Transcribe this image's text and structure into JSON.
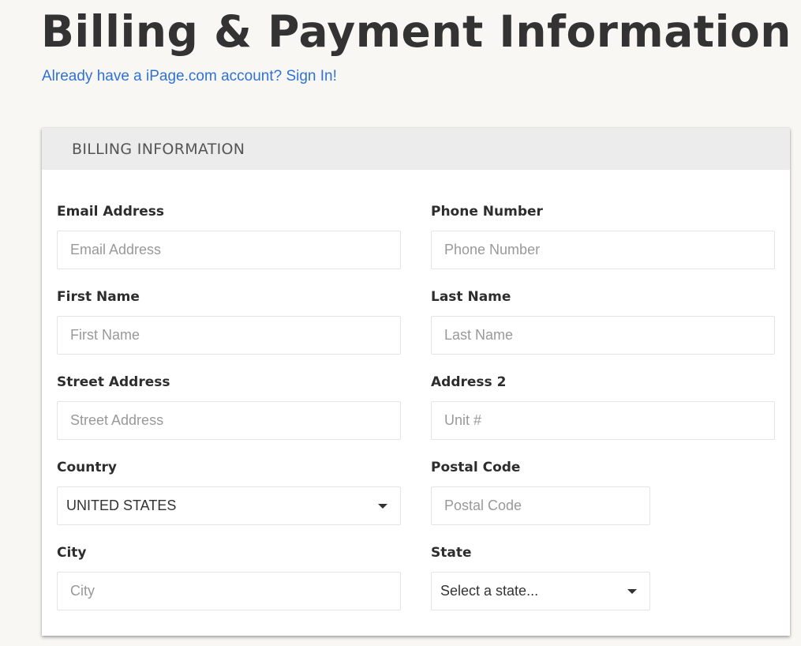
{
  "page": {
    "title": "Billing & Payment Information",
    "signin_link": "Already have a iPage.com account? Sign In!"
  },
  "billing": {
    "section_title": "BILLING INFORMATION",
    "fields": {
      "email": {
        "label": "Email Address",
        "placeholder": "Email Address",
        "value": ""
      },
      "phone": {
        "label": "Phone Number",
        "placeholder": "Phone Number",
        "value": ""
      },
      "first_name": {
        "label": "First Name",
        "placeholder": "First Name",
        "value": ""
      },
      "last_name": {
        "label": "Last Name",
        "placeholder": "Last Name",
        "value": ""
      },
      "street": {
        "label": "Street Address",
        "placeholder": "Street Address",
        "value": ""
      },
      "address2": {
        "label": "Address 2",
        "placeholder": "Unit #",
        "value": ""
      },
      "country": {
        "label": "Country",
        "selected": "UNITED STATES",
        "icon": "caret-down-icon"
      },
      "postal": {
        "label": "Postal Code",
        "placeholder": "Postal Code",
        "value": ""
      },
      "city": {
        "label": "City",
        "placeholder": "City",
        "value": ""
      },
      "state": {
        "label": "State",
        "selected": "Select a state...",
        "icon": "caret-down-icon"
      }
    }
  }
}
